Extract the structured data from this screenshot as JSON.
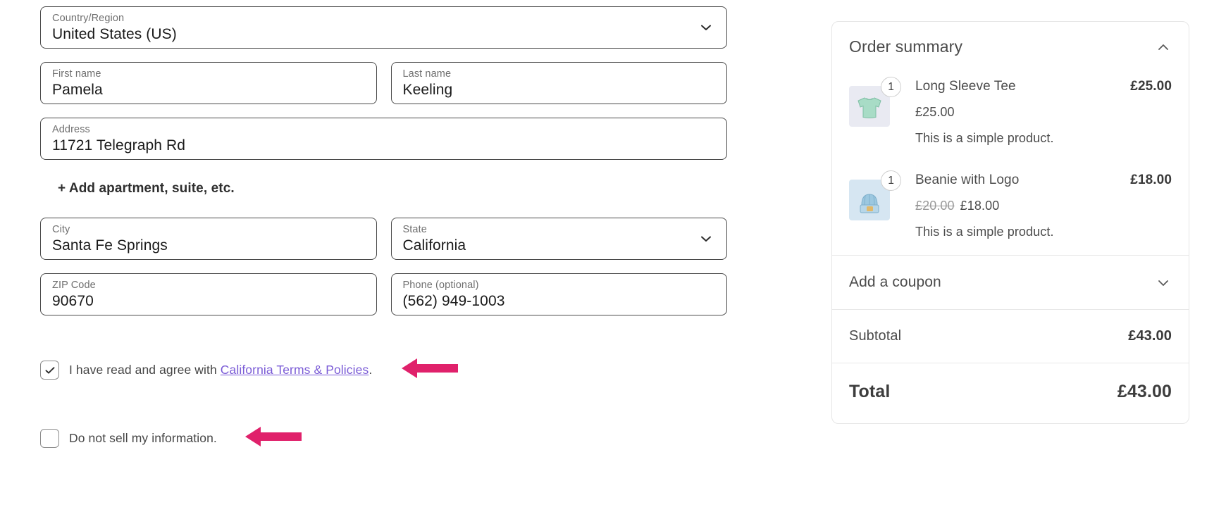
{
  "form": {
    "country": {
      "label": "Country/Region",
      "value": "United States (US)",
      "icon": "chevron-down-icon"
    },
    "first_name": {
      "label": "First name",
      "value": "Pamela"
    },
    "last_name": {
      "label": "Last name",
      "value": "Keeling"
    },
    "address": {
      "label": "Address",
      "value": "11721 Telegraph Rd"
    },
    "add_apartment_label": "+ Add apartment, suite, etc.",
    "city": {
      "label": "City",
      "value": "Santa Fe Springs"
    },
    "state": {
      "label": "State",
      "value": "California",
      "icon": "chevron-down-icon"
    },
    "zip": {
      "label": "ZIP Code",
      "value": "90670"
    },
    "phone": {
      "label": "Phone (optional)",
      "value": "(562) 949-1003"
    }
  },
  "consent": {
    "terms": {
      "checked": true,
      "text_before": "I have read and agree with ",
      "link_text": "California Terms & Policies",
      "text_after": ".",
      "annotation": "arrow-pointing-left"
    },
    "do_not_sell": {
      "checked": false,
      "text": "Do not sell my information.",
      "annotation": "arrow-pointing-left"
    }
  },
  "summary": {
    "title": "Order summary",
    "collapse_icon": "chevron-up-icon",
    "items": [
      {
        "name": "Long Sleeve Tee",
        "qty": "1",
        "line_total": "£25.00",
        "price": "£25.00",
        "price_old": "",
        "description": "This is a simple product.",
        "thumb": "long-sleeve-tee-thumbnail"
      },
      {
        "name": "Beanie with Logo",
        "qty": "1",
        "line_total": "£18.00",
        "price": "£18.00",
        "price_old": "£20.00",
        "description": "This is a simple product.",
        "thumb": "beanie-thumbnail"
      }
    ],
    "coupon": {
      "label": "Add a coupon",
      "icon": "chevron-down-icon"
    },
    "subtotal": {
      "label": "Subtotal",
      "value": "£43.00"
    },
    "total": {
      "label": "Total",
      "value": "£43.00"
    }
  },
  "colors": {
    "annotation_arrow": "#E0216B",
    "link": "#7A5BD6",
    "field_border": "#4A4A4A",
    "panel_border": "#E6E6E6"
  }
}
